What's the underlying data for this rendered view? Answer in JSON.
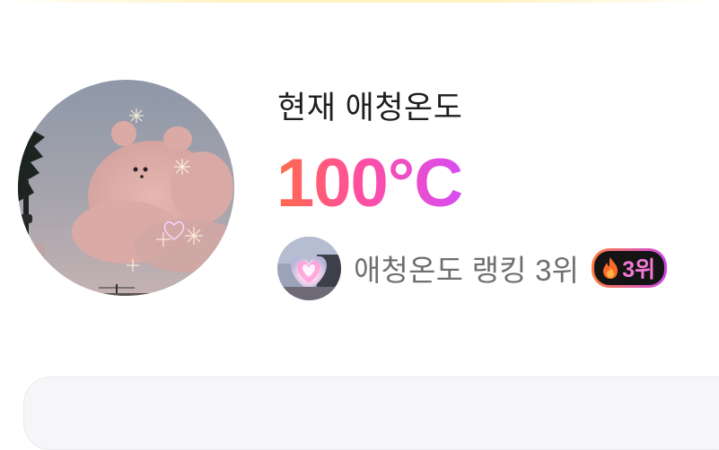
{
  "profile": {
    "temperature_label": "현재 애청온도",
    "temperature_value": "100°C"
  },
  "ranking": {
    "text": "애청온도 랭킹 3위",
    "badge": "3위",
    "badge_icon": "fire-icon"
  },
  "colors": {
    "temp_gradient_start": "#ff6a4a",
    "temp_gradient_mid": "#ff4fa0",
    "temp_gradient_end": "#d84cf2",
    "badge_background": "#141414",
    "badge_text": "#f27ad6",
    "rank_text": "#6f6f6f"
  }
}
